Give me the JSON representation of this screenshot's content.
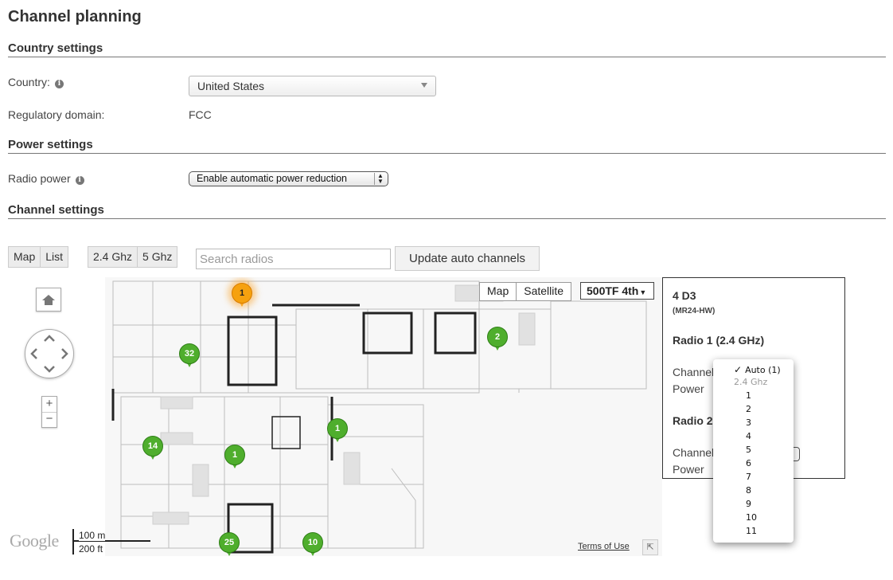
{
  "page": {
    "title": "Channel planning"
  },
  "country_settings": {
    "heading": "Country settings",
    "country_label": "Country:",
    "country_value": "United States",
    "regulatory_label": "Regulatory domain:",
    "regulatory_value": "FCC"
  },
  "power_settings": {
    "heading": "Power settings",
    "radio_power_label": "Radio power",
    "radio_power_value": "Enable automatic power reduction"
  },
  "channel_settings": {
    "heading": "Channel settings",
    "view_tabs": [
      "Map",
      "List"
    ],
    "band_tabs": [
      "2.4 Ghz",
      "5 Ghz"
    ],
    "search_placeholder": "Search radios",
    "update_button": "Update auto channels"
  },
  "map": {
    "type_buttons": [
      "Map",
      "Satellite"
    ],
    "floor_select": "500TF 4th",
    "scale": [
      "100 m",
      "200 ft"
    ],
    "terms": "Terms of Use",
    "google_logo": "Google",
    "pins": [
      {
        "label": "1",
        "color": "#f6a10f"
      },
      {
        "label": "2",
        "color": "#4fae2d"
      },
      {
        "label": "32",
        "color": "#4fae2d"
      },
      {
        "label": "1",
        "color": "#4fae2d"
      },
      {
        "label": "14",
        "color": "#4fae2d"
      },
      {
        "label": "1",
        "color": "#4fae2d"
      },
      {
        "label": "25",
        "color": "#4fae2d"
      },
      {
        "label": "10",
        "color": "#4fae2d"
      }
    ]
  },
  "info_panel": {
    "device": "4 D3",
    "model": "(MR24-HW)",
    "radio1": "Radio 1 (2.4 GHz)",
    "channel_label": "Channel",
    "power_label": "Power",
    "radio2": "Radio 2"
  },
  "channel_dropdown": {
    "selected": "Auto (1)",
    "group": "2.4 Ghz",
    "options": [
      "1",
      "2",
      "3",
      "4",
      "5",
      "6",
      "7",
      "8",
      "9",
      "10",
      "11"
    ]
  }
}
